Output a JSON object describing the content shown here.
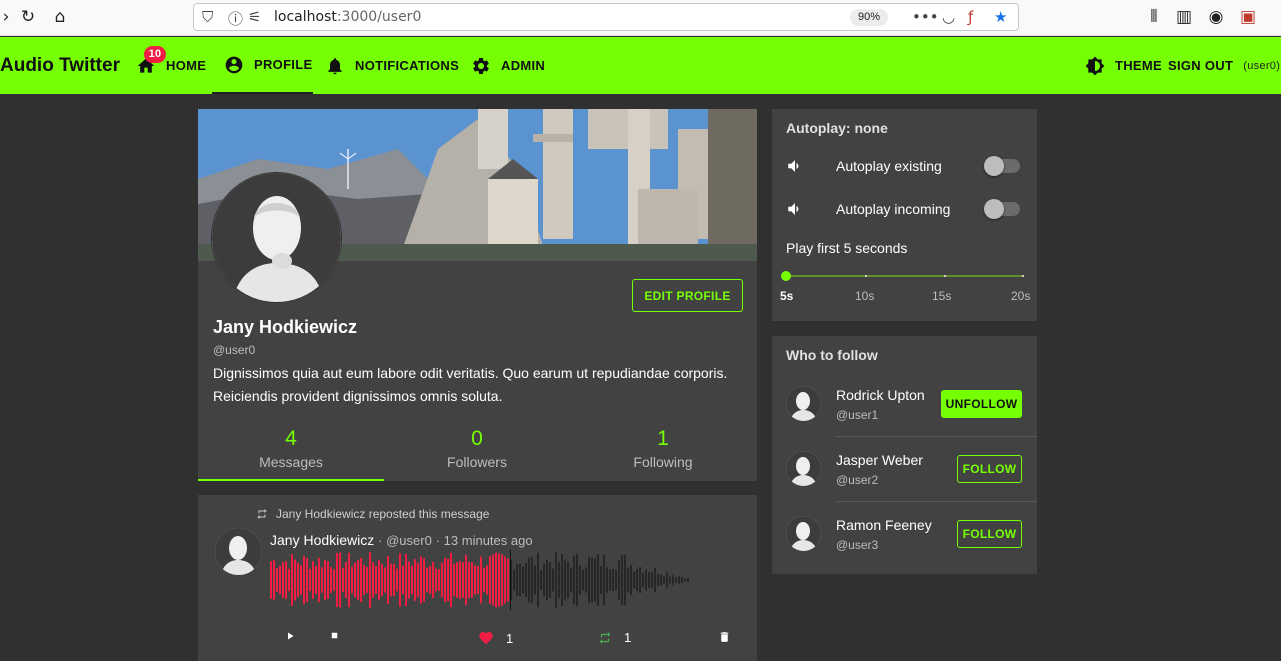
{
  "browser": {
    "url_host": "localhost",
    "url_path": ":3000/user0",
    "zoom": "90%"
  },
  "appbar": {
    "title": "Audio Twitter",
    "nav": {
      "home": "HOME",
      "home_badge": "10",
      "profile": "PROFILE",
      "notifications": "NOTIFICATIONS",
      "admin": "ADMIN",
      "theme": "THEME",
      "sign_out": "SIGN OUT",
      "current_user": "(user0)"
    },
    "accent": "#76ff03"
  },
  "profile": {
    "name": "Jany Hodkiewicz",
    "handle": "@user0",
    "bio": "Dignissimos quia aut eum labore odit veritatis. Quo earum ut repudiandae corporis. Reiciendis provident dignissimos omnis soluta.",
    "edit_button": "EDIT PROFILE",
    "stats": [
      {
        "value": "4",
        "label": "Messages"
      },
      {
        "value": "0",
        "label": "Followers"
      },
      {
        "value": "1",
        "label": "Following"
      }
    ]
  },
  "message": {
    "repost_text": "Jany Hodkiewicz reposted this message",
    "author": "Jany Hodkiewicz",
    "handle": "@user0",
    "time": "13 minutes ago",
    "likes": "1",
    "reposts": "1",
    "played_fraction": 0.57
  },
  "autoplay": {
    "title": "Autoplay: none",
    "existing_label": "Autoplay existing",
    "incoming_label": "Autoplay incoming",
    "play_first": "Play first 5 seconds",
    "slider_labels": [
      "5s",
      "10s",
      "15s",
      "20s"
    ],
    "slider_value": "5s"
  },
  "who_to_follow": {
    "title": "Who to follow",
    "users": [
      {
        "name": "Rodrick Upton",
        "handle": "@user1",
        "action": "UNFOLLOW"
      },
      {
        "name": "Jasper Weber",
        "handle": "@user2",
        "action": "FOLLOW"
      },
      {
        "name": "Ramon Feeney",
        "handle": "@user3",
        "action": "FOLLOW"
      }
    ]
  }
}
